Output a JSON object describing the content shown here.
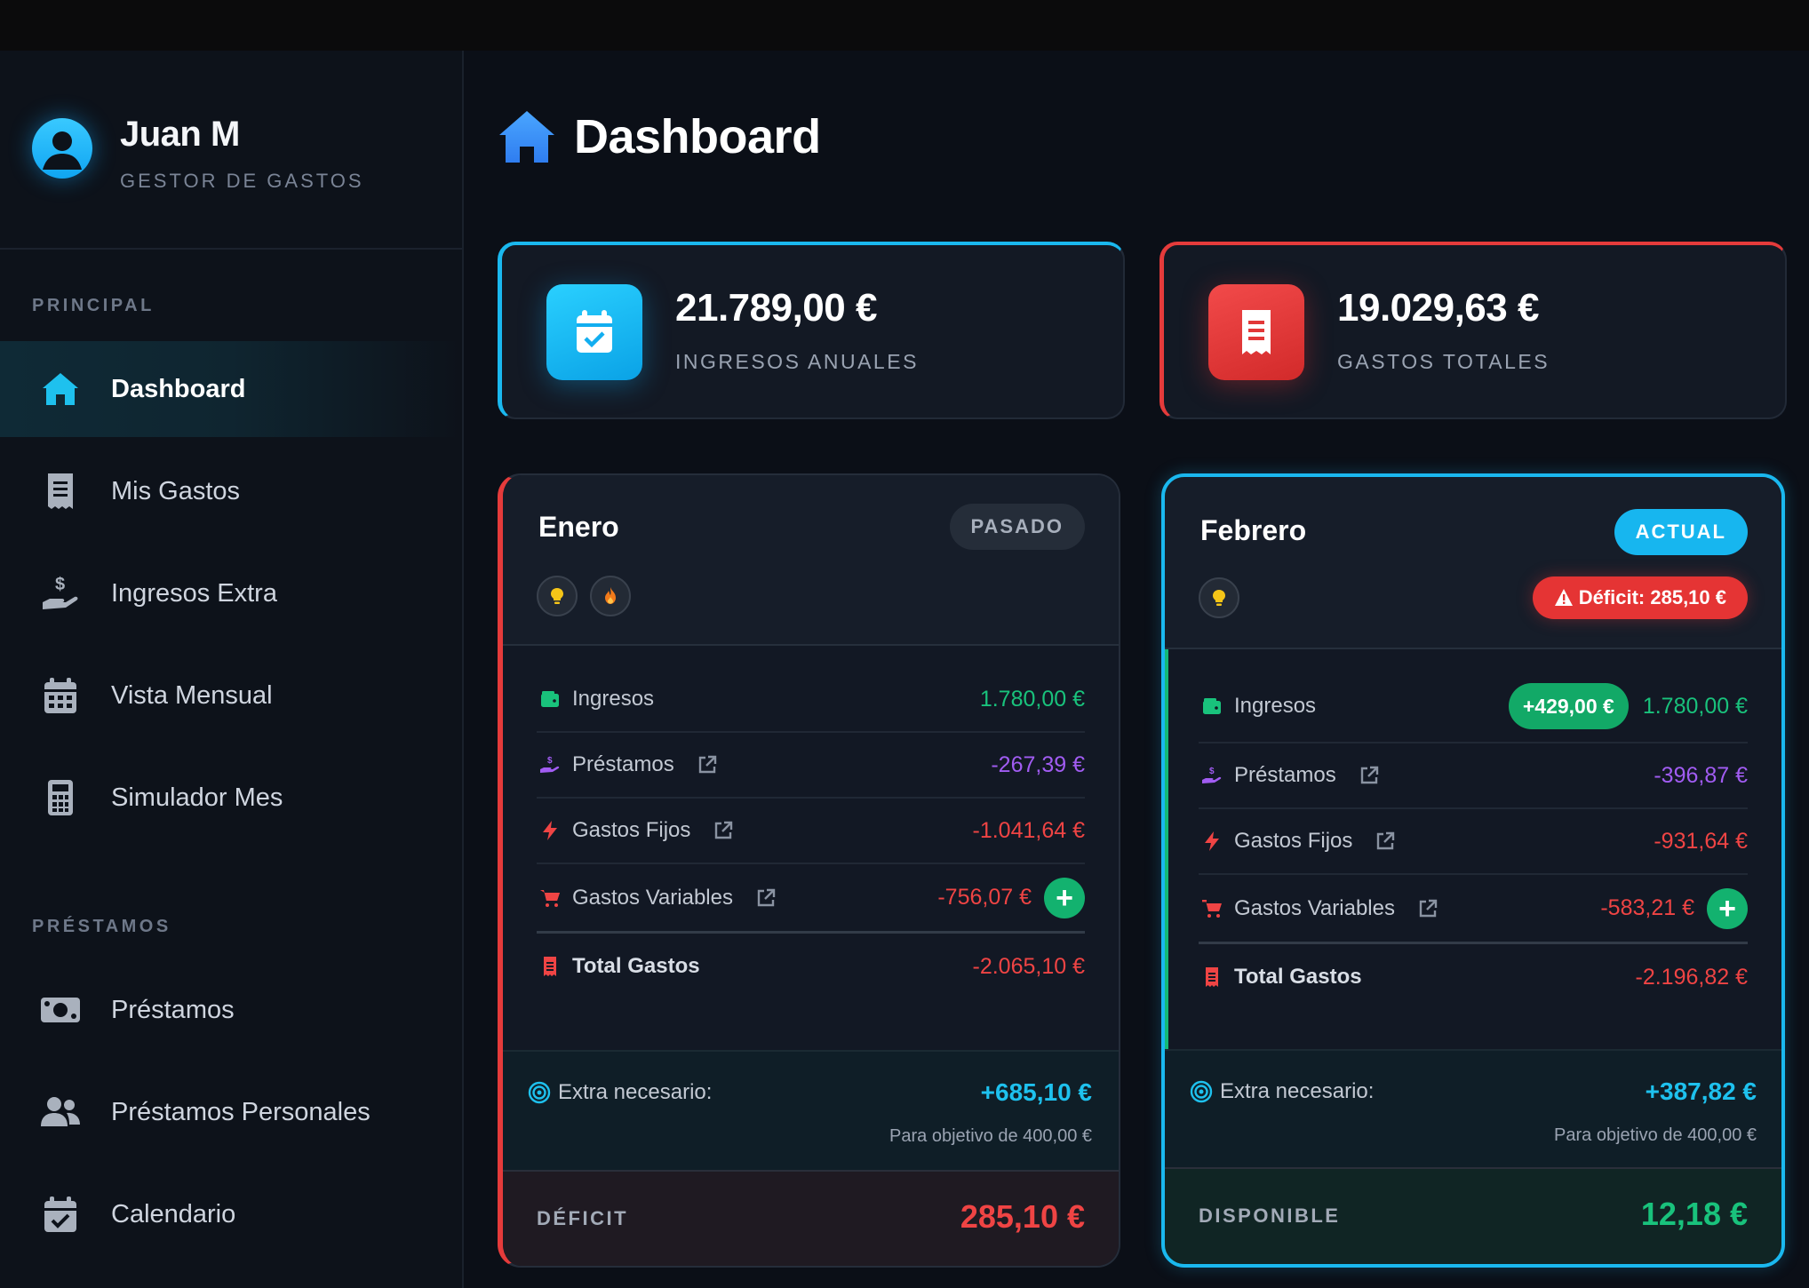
{
  "sidebar": {
    "user_name": "Juan M",
    "user_role": "GESTOR DE GASTOS",
    "section_principal": "PRINCIPAL",
    "section_prestamos": "PRÉSTAMOS",
    "items": [
      {
        "label": "Dashboard",
        "icon": "home-icon"
      },
      {
        "label": "Mis Gastos",
        "icon": "receipt-icon"
      },
      {
        "label": "Ingresos Extra",
        "icon": "hand-dollar-icon"
      },
      {
        "label": "Vista Mensual",
        "icon": "calendar-icon"
      },
      {
        "label": "Simulador Mes",
        "icon": "calculator-icon"
      },
      {
        "label": "Préstamos",
        "icon": "money-bill-icon"
      },
      {
        "label": "Préstamos Personales",
        "icon": "users-icon"
      },
      {
        "label": "Calendario",
        "icon": "calendar-check-icon"
      }
    ]
  },
  "header": {
    "title": "Dashboard"
  },
  "stats": {
    "income": {
      "value": "21.789,00 €",
      "label": "INGRESOS ANUALES"
    },
    "expenses": {
      "value": "19.029,63 €",
      "label": "GASTOS TOTALES"
    }
  },
  "months": {
    "enero": {
      "name": "Enero",
      "badge": "PASADO",
      "rows": {
        "ingresos": {
          "label": "Ingresos",
          "value": "1.780,00 €"
        },
        "prestamos": {
          "label": "Préstamos",
          "value": "-267,39 €"
        },
        "fijos": {
          "label": "Gastos Fijos",
          "value": "-1.041,64 €"
        },
        "variables": {
          "label": "Gastos Variables",
          "value": "-756,07 €"
        },
        "total": {
          "label": "Total Gastos",
          "value": "-2.065,10 €"
        }
      },
      "extra": {
        "label": "Extra necesario:",
        "value": "+685,10 €",
        "sub": "Para objetivo de 400,00 €"
      },
      "footer": {
        "label": "DÉFICIT",
        "value": "285,10 €"
      }
    },
    "febrero": {
      "name": "Febrero",
      "badge": "ACTUAL",
      "deficit_alert": "Déficit: 285,10 €",
      "rows": {
        "ingresos": {
          "label": "Ingresos",
          "diff": "+429,00 €",
          "value": "1.780,00 €"
        },
        "prestamos": {
          "label": "Préstamos",
          "value": "-396,87 €"
        },
        "fijos": {
          "label": "Gastos Fijos",
          "value": "-931,64 €"
        },
        "variables": {
          "label": "Gastos Variables",
          "value": "-583,21 €"
        },
        "total": {
          "label": "Total Gastos",
          "value": "-2.196,82 €"
        }
      },
      "extra": {
        "label": "Extra necesario:",
        "value": "+387,82 €",
        "sub": "Para objetivo de 400,00 €"
      },
      "footer": {
        "label": "DISPONIBLE",
        "value": "12,18 €"
      }
    }
  },
  "colors": {
    "accent_cyan": "#1ab8ef",
    "danger_red": "#e53b3b",
    "success_green": "#19c27c",
    "loan_purple": "#a15cf2"
  }
}
